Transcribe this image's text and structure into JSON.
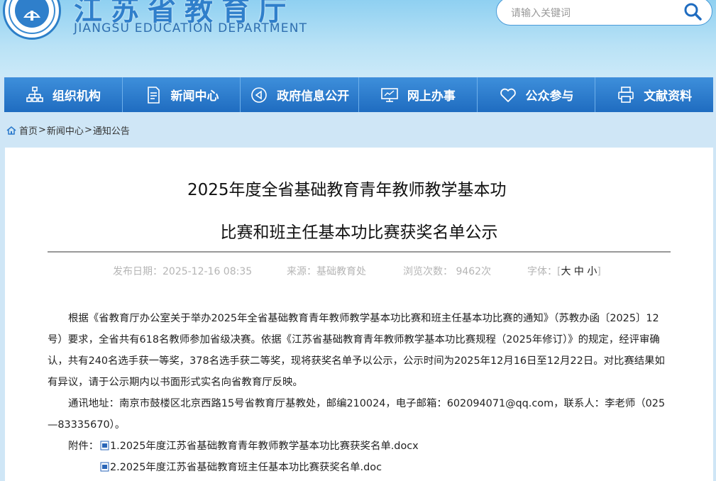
{
  "header": {
    "title": "江苏省教育厅",
    "subtitle": "JIANGSU EDUCATION DEPARTMENT",
    "logo_icon": "education-emblem-icon",
    "search_placeholder": "请输入关键词",
    "search_icon": "search-icon",
    "brand_color": "#2f7fcb"
  },
  "nav": {
    "items": [
      {
        "label": "组织机构",
        "icon": "org-chart-icon"
      },
      {
        "label": "新闻中心",
        "icon": "document-icon"
      },
      {
        "label": "政府信息公开",
        "icon": "speaker-icon"
      },
      {
        "label": "网上办事",
        "icon": "monitor-icon"
      },
      {
        "label": "公众参与",
        "icon": "heart-icon"
      },
      {
        "label": "文献资料",
        "icon": "printer-icon"
      }
    ],
    "color": "#2a79cc"
  },
  "breadcrumb": {
    "icon": "home-icon",
    "items": [
      "首页",
      "新闻中心",
      "通知公告"
    ]
  },
  "article": {
    "title_line1": "2025年度全省基础教育青年教师教学基本功",
    "title_line2": "比赛和班主任基本功比赛获奖名单公示",
    "meta": {
      "date": "发布日期：2025-12-16 08:35",
      "source": "来源：基础教育处",
      "views": "浏览次数： 9462次",
      "font_label": "字体：",
      "font_open": "[",
      "font_large": "大",
      "font_medium": "中",
      "font_small": "小",
      "font_close": "]"
    },
    "paragraph1": "根据《省教育厅办公室关于举办2025年全省基础教育青年教师教学基本功比赛和班主任基本功比赛的通知》（苏教办函〔2025〕12号）要求，全省共有618名教师参加省级决赛。依据《江苏省基础教育青年教师教学基本功比赛规程（2025年修订）》的规定，经评审确认，共有240名选手获一等奖，378名选手获二等奖，现将获奖名单予以公示，公示时间为2025年12月16日至12月22日。对比赛结果如有异议，请于公示期内以书面形式实名向省教育厅反映。",
    "paragraph2": "通讯地址：南京市鼓楼区北京西路15号省教育厅基教处，邮编210024，电子邮箱：602094071@qq.com，联系人：李老师（025—83335670）。",
    "attachment_label": "附件：",
    "attachments": [
      {
        "name": "1.2025年度江苏省基础教育青年教师教学基本功比赛获奖名单.docx",
        "icon": "doc-file-icon"
      },
      {
        "name": "2.2025年度江苏省基础教育班主任基本功比赛获奖名单.doc",
        "icon": "doc-file-icon"
      }
    ]
  }
}
